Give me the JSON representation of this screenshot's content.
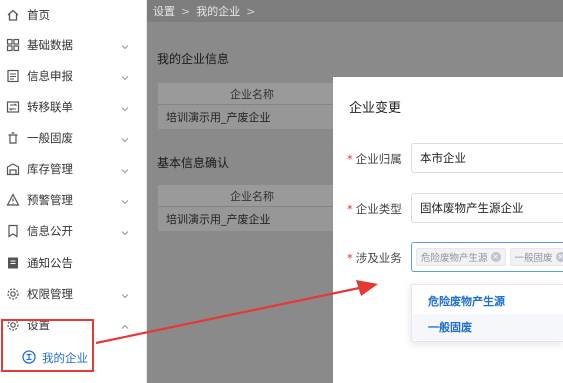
{
  "sidebar": {
    "items": [
      {
        "label": "首页",
        "icon": "home-icon",
        "has_arrow": false
      },
      {
        "label": "基础数据",
        "icon": "grid-icon",
        "has_arrow": true
      },
      {
        "label": "信息申报",
        "icon": "report-icon",
        "has_arrow": true
      },
      {
        "label": "转移联单",
        "icon": "transfer-icon",
        "has_arrow": true
      },
      {
        "label": "一般固废",
        "icon": "waste-icon",
        "has_arrow": true
      },
      {
        "label": "库存管理",
        "icon": "warehouse-icon",
        "has_arrow": true
      },
      {
        "label": "预警管理",
        "icon": "alert-icon",
        "has_arrow": true
      },
      {
        "label": "信息公开",
        "icon": "bookmark-icon",
        "has_arrow": true
      },
      {
        "label": "通知公告",
        "icon": "notice-icon",
        "has_arrow": false
      },
      {
        "label": "权限管理",
        "icon": "gear-icon",
        "has_arrow": true
      },
      {
        "label": "设置",
        "icon": "settings-icon",
        "has_arrow": true,
        "expanded": true
      }
    ],
    "sub_item": {
      "label": "我的企业",
      "icon": "enterprise-icon"
    }
  },
  "breadcrumb": [
    "设置",
    "我的企业"
  ],
  "main": {
    "section1_title": "我的企业信息",
    "section1_table": {
      "header": "企业名称",
      "value": "培训演示用_产废企业"
    },
    "section2_title": "基本信息确认",
    "section2_table": {
      "header": "企业名称",
      "value": "培训演示用_产废企业"
    }
  },
  "dialog": {
    "title": "企业变更",
    "fields": [
      {
        "label": "企业归属",
        "value": "本市企业",
        "required": true
      },
      {
        "label": "企业类型",
        "value": "固体废物产生源企业",
        "required": true
      },
      {
        "label": "涉及业务",
        "required": true,
        "tags": [
          "危险废物产生源",
          "一般固废"
        ]
      }
    ],
    "dropdown_options": [
      "危险废物产生源",
      "一般固废"
    ]
  },
  "colors": {
    "accent": "#1f6fd1",
    "annotation": "#e53935",
    "overlay": "#8a8a8a"
  }
}
